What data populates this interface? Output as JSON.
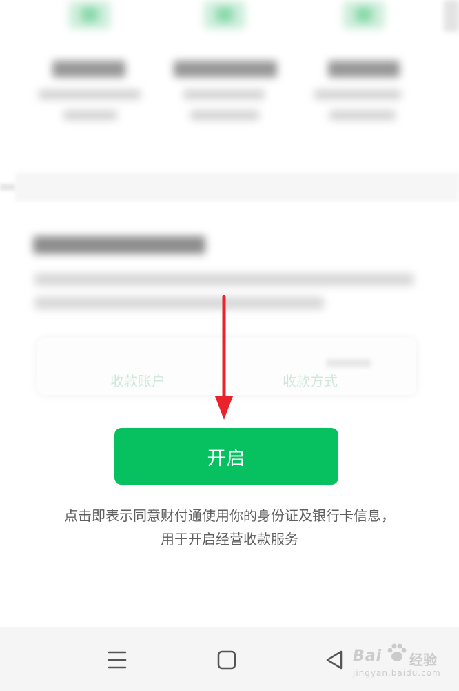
{
  "receipt_card": {
    "account_label": "收款账户",
    "method_label": "收款方式"
  },
  "main": {
    "open_button_label": "开启",
    "consent_line_1": "点击即表示同意财付通使用你的身份证及银行卡信息，",
    "consent_line_2": "用于开启经营收款服务"
  },
  "navbar": {
    "items": [
      {
        "icon": "menu-icon"
      },
      {
        "icon": "home-square-icon"
      },
      {
        "icon": "back-triangle-icon"
      }
    ]
  },
  "watermark": {
    "brand": "Bai",
    "brand_suffix": "经验",
    "url": "jingyan.baidu.com"
  },
  "colors": {
    "accent": "#07c160",
    "annotation_arrow": "#e8232b",
    "navbar_bg": "#f5f5f5"
  }
}
